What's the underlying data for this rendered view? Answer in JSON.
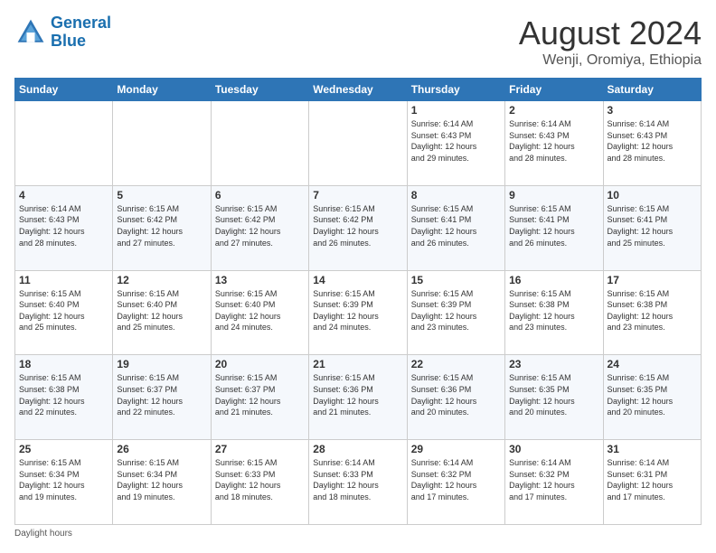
{
  "header": {
    "logo_line1": "General",
    "logo_line2": "Blue",
    "month_title": "August 2024",
    "location": "Wenji, Oromiya, Ethiopia"
  },
  "days_of_week": [
    "Sunday",
    "Monday",
    "Tuesday",
    "Wednesday",
    "Thursday",
    "Friday",
    "Saturday"
  ],
  "weeks": [
    [
      {
        "day": "",
        "info": ""
      },
      {
        "day": "",
        "info": ""
      },
      {
        "day": "",
        "info": ""
      },
      {
        "day": "",
        "info": ""
      },
      {
        "day": "1",
        "info": "Sunrise: 6:14 AM\nSunset: 6:43 PM\nDaylight: 12 hours\nand 29 minutes."
      },
      {
        "day": "2",
        "info": "Sunrise: 6:14 AM\nSunset: 6:43 PM\nDaylight: 12 hours\nand 28 minutes."
      },
      {
        "day": "3",
        "info": "Sunrise: 6:14 AM\nSunset: 6:43 PM\nDaylight: 12 hours\nand 28 minutes."
      }
    ],
    [
      {
        "day": "4",
        "info": "Sunrise: 6:14 AM\nSunset: 6:43 PM\nDaylight: 12 hours\nand 28 minutes."
      },
      {
        "day": "5",
        "info": "Sunrise: 6:15 AM\nSunset: 6:42 PM\nDaylight: 12 hours\nand 27 minutes."
      },
      {
        "day": "6",
        "info": "Sunrise: 6:15 AM\nSunset: 6:42 PM\nDaylight: 12 hours\nand 27 minutes."
      },
      {
        "day": "7",
        "info": "Sunrise: 6:15 AM\nSunset: 6:42 PM\nDaylight: 12 hours\nand 26 minutes."
      },
      {
        "day": "8",
        "info": "Sunrise: 6:15 AM\nSunset: 6:41 PM\nDaylight: 12 hours\nand 26 minutes."
      },
      {
        "day": "9",
        "info": "Sunrise: 6:15 AM\nSunset: 6:41 PM\nDaylight: 12 hours\nand 26 minutes."
      },
      {
        "day": "10",
        "info": "Sunrise: 6:15 AM\nSunset: 6:41 PM\nDaylight: 12 hours\nand 25 minutes."
      }
    ],
    [
      {
        "day": "11",
        "info": "Sunrise: 6:15 AM\nSunset: 6:40 PM\nDaylight: 12 hours\nand 25 minutes."
      },
      {
        "day": "12",
        "info": "Sunrise: 6:15 AM\nSunset: 6:40 PM\nDaylight: 12 hours\nand 25 minutes."
      },
      {
        "day": "13",
        "info": "Sunrise: 6:15 AM\nSunset: 6:40 PM\nDaylight: 12 hours\nand 24 minutes."
      },
      {
        "day": "14",
        "info": "Sunrise: 6:15 AM\nSunset: 6:39 PM\nDaylight: 12 hours\nand 24 minutes."
      },
      {
        "day": "15",
        "info": "Sunrise: 6:15 AM\nSunset: 6:39 PM\nDaylight: 12 hours\nand 23 minutes."
      },
      {
        "day": "16",
        "info": "Sunrise: 6:15 AM\nSunset: 6:38 PM\nDaylight: 12 hours\nand 23 minutes."
      },
      {
        "day": "17",
        "info": "Sunrise: 6:15 AM\nSunset: 6:38 PM\nDaylight: 12 hours\nand 23 minutes."
      }
    ],
    [
      {
        "day": "18",
        "info": "Sunrise: 6:15 AM\nSunset: 6:38 PM\nDaylight: 12 hours\nand 22 minutes."
      },
      {
        "day": "19",
        "info": "Sunrise: 6:15 AM\nSunset: 6:37 PM\nDaylight: 12 hours\nand 22 minutes."
      },
      {
        "day": "20",
        "info": "Sunrise: 6:15 AM\nSunset: 6:37 PM\nDaylight: 12 hours\nand 21 minutes."
      },
      {
        "day": "21",
        "info": "Sunrise: 6:15 AM\nSunset: 6:36 PM\nDaylight: 12 hours\nand 21 minutes."
      },
      {
        "day": "22",
        "info": "Sunrise: 6:15 AM\nSunset: 6:36 PM\nDaylight: 12 hours\nand 20 minutes."
      },
      {
        "day": "23",
        "info": "Sunrise: 6:15 AM\nSunset: 6:35 PM\nDaylight: 12 hours\nand 20 minutes."
      },
      {
        "day": "24",
        "info": "Sunrise: 6:15 AM\nSunset: 6:35 PM\nDaylight: 12 hours\nand 20 minutes."
      }
    ],
    [
      {
        "day": "25",
        "info": "Sunrise: 6:15 AM\nSunset: 6:34 PM\nDaylight: 12 hours\nand 19 minutes."
      },
      {
        "day": "26",
        "info": "Sunrise: 6:15 AM\nSunset: 6:34 PM\nDaylight: 12 hours\nand 19 minutes."
      },
      {
        "day": "27",
        "info": "Sunrise: 6:15 AM\nSunset: 6:33 PM\nDaylight: 12 hours\nand 18 minutes."
      },
      {
        "day": "28",
        "info": "Sunrise: 6:14 AM\nSunset: 6:33 PM\nDaylight: 12 hours\nand 18 minutes."
      },
      {
        "day": "29",
        "info": "Sunrise: 6:14 AM\nSunset: 6:32 PM\nDaylight: 12 hours\nand 17 minutes."
      },
      {
        "day": "30",
        "info": "Sunrise: 6:14 AM\nSunset: 6:32 PM\nDaylight: 12 hours\nand 17 minutes."
      },
      {
        "day": "31",
        "info": "Sunrise: 6:14 AM\nSunset: 6:31 PM\nDaylight: 12 hours\nand 17 minutes."
      }
    ]
  ],
  "footer": {
    "daylight_label": "Daylight hours"
  }
}
